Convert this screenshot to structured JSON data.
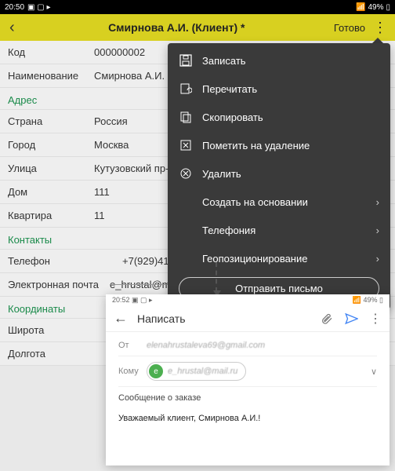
{
  "status": {
    "time": "20:50",
    "battery": "49%"
  },
  "header": {
    "title": "Смирнова А.И. (Клиент) *",
    "done": "Готово"
  },
  "form": {
    "code_label": "Код",
    "code_value": "000000002",
    "name_label": "Наименование",
    "name_value": "Смирнова А.И.",
    "section_address": "Адрес",
    "country_label": "Страна",
    "country_value": "Россия",
    "city_label": "Город",
    "city_value": "Москва",
    "street_label": "Улица",
    "street_value": "Кутузовский пр-т",
    "house_label": "Дом",
    "house_value": "111",
    "apt_label": "Квартира",
    "apt_value": "11",
    "section_contacts": "Контакты",
    "phone_label": "Телефон",
    "phone_value": "+7(929)410-57-90",
    "email_label": "Электронная почта",
    "email_value": "e_hrustal@mail.ru",
    "section_coords": "Координаты",
    "lat_label": "Широта",
    "lon_label": "Долгота"
  },
  "menu": {
    "save": "Записать",
    "reread": "Перечитать",
    "copy": "Скопировать",
    "mark_delete": "Пометить на удаление",
    "delete": "Удалить",
    "create_based": "Создать на основании",
    "telephony": "Телефония",
    "geo": "Геопозиционирование",
    "send_mail": "Отправить письмо"
  },
  "compose": {
    "status_time": "20:52",
    "status_battery": "49%",
    "title": "Написать",
    "from_label": "От",
    "from_value": "elenahrustaleva69@gmail.com",
    "to_label": "Кому",
    "to_chip_avatar": "e",
    "to_chip_value": "e_hrustal@mail.ru",
    "subject": "Сообщение о заказе",
    "body": "Уважаемый клиент, Смирнова А.И.!"
  }
}
